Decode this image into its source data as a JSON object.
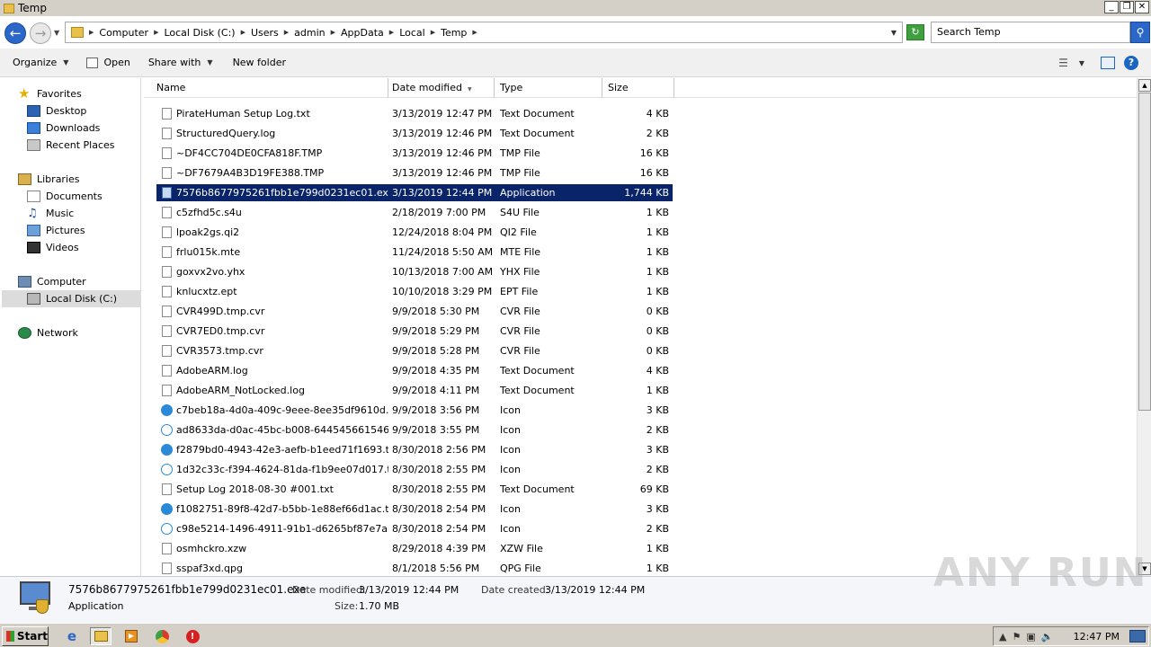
{
  "window": {
    "title": "Temp",
    "minimize": "_",
    "restore": "❐",
    "close": "✕"
  },
  "address": {
    "crumbs": [
      "Computer",
      "Local Disk (C:)",
      "Users",
      "admin",
      "AppData",
      "Local",
      "Temp"
    ],
    "search_placeholder": "Search Temp"
  },
  "toolbar": {
    "organize": "Organize",
    "open": "Open",
    "share_with": "Share with",
    "new_folder": "New folder"
  },
  "nav": {
    "favorites": "Favorites",
    "desktop": "Desktop",
    "downloads": "Downloads",
    "recent_places": "Recent Places",
    "libraries": "Libraries",
    "documents": "Documents",
    "music": "Music",
    "pictures": "Pictures",
    "videos": "Videos",
    "computer": "Computer",
    "local_disk": "Local Disk (C:)",
    "network": "Network"
  },
  "columns": {
    "name": "Name",
    "date": "Date modified",
    "type": "Type",
    "size": "Size"
  },
  "files": [
    {
      "name": "PirateHuman Setup Log.txt",
      "date": "3/13/2019 12:47 PM",
      "type": "Text Document",
      "size": "4 KB",
      "icon": "doc"
    },
    {
      "name": "StructuredQuery.log",
      "date": "3/13/2019 12:46 PM",
      "type": "Text Document",
      "size": "2 KB",
      "icon": "doc"
    },
    {
      "name": "~DF4CC704DE0CFA818F.TMP",
      "date": "3/13/2019 12:46 PM",
      "type": "TMP File",
      "size": "16 KB",
      "icon": "file"
    },
    {
      "name": "~DF7679A4B3D19FE388.TMP",
      "date": "3/13/2019 12:46 PM",
      "type": "TMP File",
      "size": "16 KB",
      "icon": "file"
    },
    {
      "name": "7576b8677975261fbb1e799d0231ec01.exe",
      "date": "3/13/2019 12:44 PM",
      "type": "Application",
      "size": "1,744 KB",
      "icon": "app",
      "selected": true
    },
    {
      "name": "c5zfhd5c.s4u",
      "date": "2/18/2019 7:00 PM",
      "type": "S4U File",
      "size": "1 KB",
      "icon": "file"
    },
    {
      "name": "lpoak2gs.qi2",
      "date": "12/24/2018 8:04 PM",
      "type": "QI2 File",
      "size": "1 KB",
      "icon": "file"
    },
    {
      "name": "frlu015k.mte",
      "date": "11/24/2018 5:50 AM",
      "type": "MTE File",
      "size": "1 KB",
      "icon": "file"
    },
    {
      "name": "goxvx2vo.yhx",
      "date": "10/13/2018 7:00 AM",
      "type": "YHX File",
      "size": "1 KB",
      "icon": "file"
    },
    {
      "name": "knlucxtz.ept",
      "date": "10/10/2018 3:29 PM",
      "type": "EPT File",
      "size": "1 KB",
      "icon": "file"
    },
    {
      "name": "CVR499D.tmp.cvr",
      "date": "9/9/2018 5:30 PM",
      "type": "CVR File",
      "size": "0 KB",
      "icon": "file"
    },
    {
      "name": "CVR7ED0.tmp.cvr",
      "date": "9/9/2018 5:29 PM",
      "type": "CVR File",
      "size": "0 KB",
      "icon": "file"
    },
    {
      "name": "CVR3573.tmp.cvr",
      "date": "9/9/2018 5:28 PM",
      "type": "CVR File",
      "size": "0 KB",
      "icon": "file"
    },
    {
      "name": "AdobeARM.log",
      "date": "9/9/2018 4:35 PM",
      "type": "Text Document",
      "size": "4 KB",
      "icon": "doc"
    },
    {
      "name": "AdobeARM_NotLocked.log",
      "date": "9/9/2018 4:11 PM",
      "type": "Text Document",
      "size": "1 KB",
      "icon": "doc"
    },
    {
      "name": "c7beb18a-4d0a-409c-9eee-8ee35df9610d.t...",
      "date": "9/9/2018 3:56 PM",
      "type": "Icon",
      "size": "3 KB",
      "icon": "skype-fill"
    },
    {
      "name": "ad8633da-d0ac-45bc-b008-644545661546.t...",
      "date": "9/9/2018 3:55 PM",
      "type": "Icon",
      "size": "2 KB",
      "icon": "skype"
    },
    {
      "name": "f2879bd0-4943-42e3-aefb-b1eed71f1693.t...",
      "date": "8/30/2018 2:56 PM",
      "type": "Icon",
      "size": "3 KB",
      "icon": "skype-fill"
    },
    {
      "name": "1d32c33c-f394-4624-81da-f1b9ee07d017.t...",
      "date": "8/30/2018 2:55 PM",
      "type": "Icon",
      "size": "2 KB",
      "icon": "skype"
    },
    {
      "name": "Setup Log 2018-08-30 #001.txt",
      "date": "8/30/2018 2:55 PM",
      "type": "Text Document",
      "size": "69 KB",
      "icon": "doc"
    },
    {
      "name": "f1082751-89f8-42d7-b5bb-1e88ef66d1ac.t...",
      "date": "8/30/2018 2:54 PM",
      "type": "Icon",
      "size": "3 KB",
      "icon": "skype-fill"
    },
    {
      "name": "c98e5214-1496-4911-91b1-d6265bf87e7a.t...",
      "date": "8/30/2018 2:54 PM",
      "type": "Icon",
      "size": "2 KB",
      "icon": "skype"
    },
    {
      "name": "osmhckro.xzw",
      "date": "8/29/2018 4:39 PM",
      "type": "XZW File",
      "size": "1 KB",
      "icon": "file"
    },
    {
      "name": "sspaf3xd.qpg",
      "date": "8/1/2018 5:56 PM",
      "type": "QPG File",
      "size": "1 KB",
      "icon": "file"
    }
  ],
  "details": {
    "name": "7576b8677975261fbb1e799d0231ec01.exe",
    "type": "Application",
    "modified_label": "Date modified:",
    "modified": "3/13/2019 12:44 PM",
    "created_label": "Date created:",
    "created": "3/13/2019 12:44 PM",
    "size_label": "Size:",
    "size": "1.70 MB"
  },
  "taskbar": {
    "start": "Start",
    "clock": "12:47 PM"
  },
  "watermark": "ANY RUN",
  "colors": {
    "selection": "#0a246a",
    "accent": "#2a67c9",
    "window_chrome": "#d4d0c8"
  }
}
